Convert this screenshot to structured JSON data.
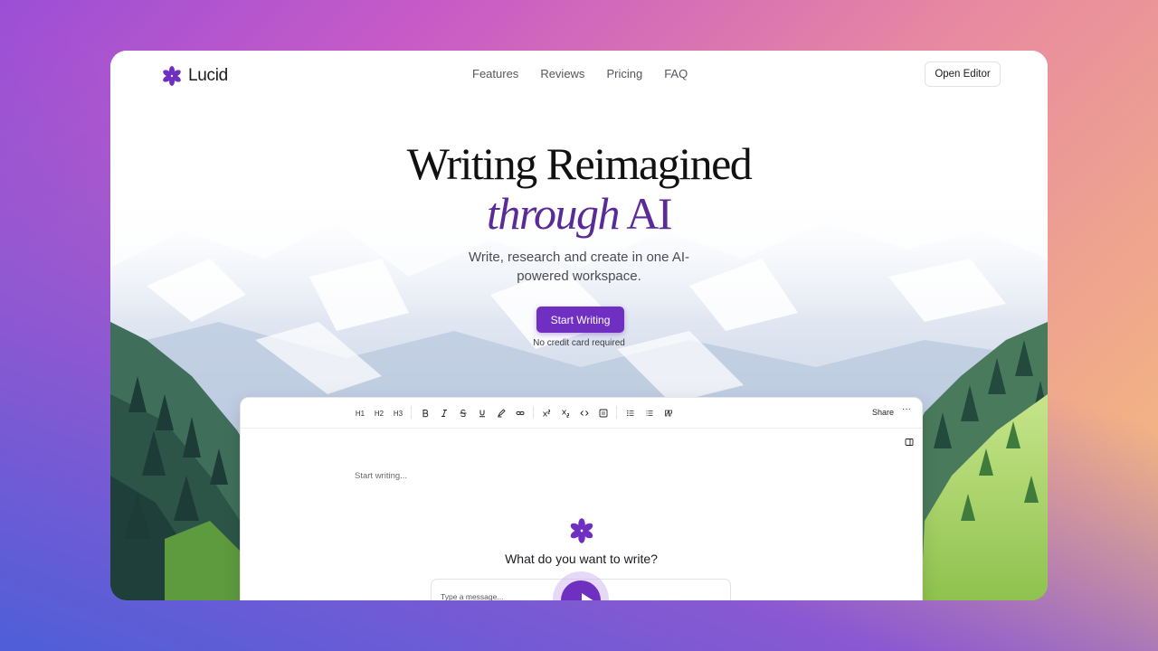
{
  "brand": {
    "name": "Lucid",
    "accent": "#6f2fc0"
  },
  "nav": {
    "links": [
      "Features",
      "Reviews",
      "Pricing",
      "FAQ"
    ],
    "cta": "Open Editor"
  },
  "hero": {
    "title_line1": "Writing Reimagined",
    "title_line2_italic": "through",
    "title_line2_rest": "AI",
    "subtitle": "Write, research and create in one AI-powered workspace.",
    "cta": "Start Writing",
    "cta_note": "No credit card required"
  },
  "editor": {
    "toolbar": {
      "headings": [
        "H1",
        "H2",
        "H3"
      ],
      "format_icons": [
        "bold-icon",
        "italic-icon",
        "strikethrough-icon",
        "underline-icon",
        "highlight-icon",
        "link-icon"
      ],
      "script_icons": [
        "superscript-icon",
        "subscript-icon",
        "code-icon",
        "code-block-icon"
      ],
      "list_icons": [
        "bullet-list-icon",
        "ordered-list-icon",
        "quote-icon"
      ],
      "share_label": "Share",
      "more_label": "···"
    },
    "placeholder": "Start writing...",
    "prompt_title": "What do you want to write?",
    "message_placeholder": "Type a message..."
  }
}
